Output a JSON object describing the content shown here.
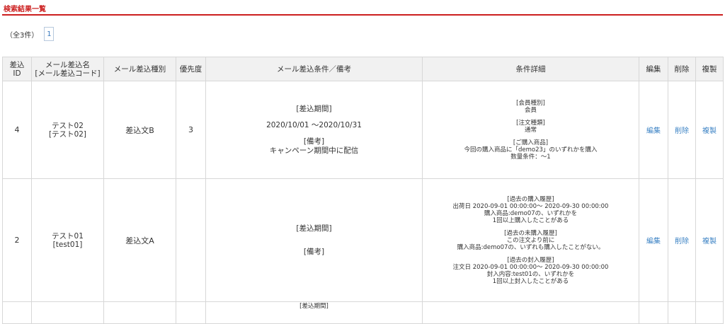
{
  "header": {
    "title": "検索結果一覧"
  },
  "pager": {
    "count_text": "（全3件）",
    "current_page": "1"
  },
  "columns": {
    "id": "差込ID",
    "name_line1": "メール差込名",
    "name_line2": "[メール差込コード]",
    "type": "メール差込種別",
    "priority": "優先度",
    "conditions": "メール差込条件／備考",
    "detail": "条件詳細",
    "edit": "編集",
    "delete": "削除",
    "copy": "複製"
  },
  "rows": [
    {
      "id": "4",
      "name": "テスト02",
      "code": "[テスト02]",
      "type": "差込文B",
      "priority": "3",
      "period_label": "[差込期間]",
      "period_value": "2020/10/01 ～2020/10/31",
      "note_label": "[備考]",
      "note_value": "キャンペーン期間中に配信",
      "detail": {
        "l1": "[会員種別]",
        "l2": "会員",
        "l3": "[注文種類]",
        "l4": "通常",
        "l5": "[ご購入商品]",
        "l6": "今回の購入商品に「demo23」のいずれかを購入",
        "l7": "数量条件：～1"
      },
      "edit": "編集",
      "delete": "削除",
      "copy": "複製"
    },
    {
      "id": "2",
      "name": "テスト01",
      "code": "[test01]",
      "type": "差込文A",
      "priority": "",
      "period_label": "[差込期間]",
      "note_label": "[備考]",
      "detail": {
        "l1": "[過去の購入履歴]",
        "l2": "出荷日 2020-09-01 00:00:00～ 2020-09-30 00:00:00",
        "l3": "購入商品:demo07の、いずれかを",
        "l4": "1回以上購入したことがある",
        "l5": "[過去の未購入履歴]",
        "l6": "この注文より前に",
        "l7": "購入商品:demo07の、いずれも購入したことがない。",
        "l8": "[過去の封入履歴]",
        "l9": "注文日 2020-09-01 00:00:00～ 2020-09-30 00:00:00",
        "l10": "封入内容:test01の、いずれかを",
        "l11": "1回以上封入したことがある"
      },
      "edit": "編集",
      "delete": "削除",
      "copy": "複製"
    },
    {
      "partial_text": "[差込期間]"
    }
  ]
}
